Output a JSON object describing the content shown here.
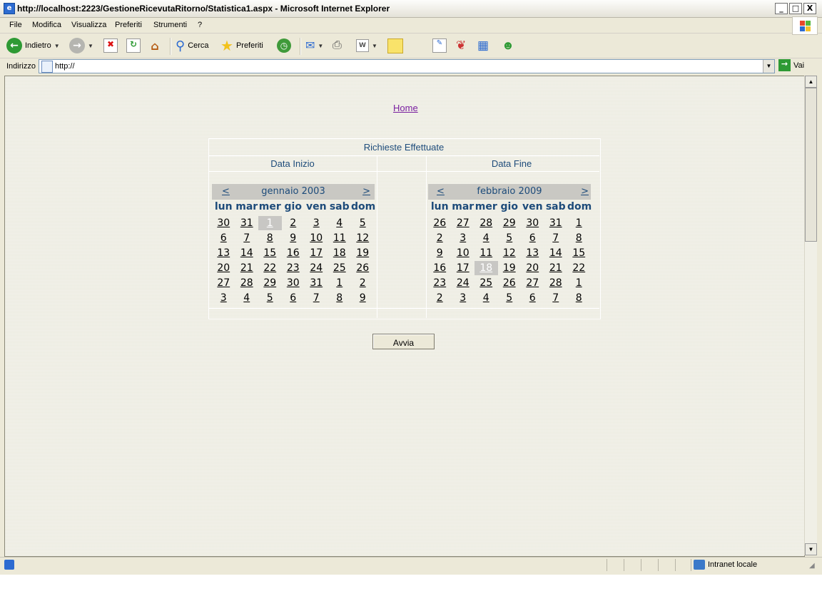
{
  "window": {
    "title": "http://localhost:2223/GestioneRicevutaRitorno/Statistica1.aspx - Microsoft Internet Explorer",
    "controls": [
      "_",
      "□",
      "X"
    ]
  },
  "menu": [
    "File",
    "Modifica",
    "Visualizza",
    "Preferiti",
    "Strumenti",
    "?"
  ],
  "toolbar": {
    "back": "Indietro",
    "search": "Cerca",
    "favorites": "Preferiti"
  },
  "address": {
    "label": "Indirizzo",
    "value": "http://",
    "go": "Vai"
  },
  "page": {
    "home_link": "Home",
    "table_title": "Richieste Effettuate",
    "start_label": "Data Inizio",
    "end_label": "Data Fine",
    "submit": "Avvia"
  },
  "calendars": [
    {
      "prev": "<",
      "next": ">",
      "month": "gennaio 2003",
      "dows": [
        "lun",
        "mar",
        "mer",
        "gio",
        "ven",
        "sab",
        "dom"
      ],
      "weeks": [
        [
          "30",
          "31",
          "1",
          "2",
          "3",
          "4",
          "5"
        ],
        [
          "6",
          "7",
          "8",
          "9",
          "10",
          "11",
          "12"
        ],
        [
          "13",
          "14",
          "15",
          "16",
          "17",
          "18",
          "19"
        ],
        [
          "20",
          "21",
          "22",
          "23",
          "24",
          "25",
          "26"
        ],
        [
          "27",
          "28",
          "29",
          "30",
          "31",
          "1",
          "2"
        ],
        [
          "3",
          "4",
          "5",
          "6",
          "7",
          "8",
          "9"
        ]
      ],
      "selected": [
        0,
        2
      ]
    },
    {
      "prev": "<",
      "next": ">",
      "month": "febbraio 2009",
      "dows": [
        "lun",
        "mar",
        "mer",
        "gio",
        "ven",
        "sab",
        "dom"
      ],
      "weeks": [
        [
          "26",
          "27",
          "28",
          "29",
          "30",
          "31",
          "1"
        ],
        [
          "2",
          "3",
          "4",
          "5",
          "6",
          "7",
          "8"
        ],
        [
          "9",
          "10",
          "11",
          "12",
          "13",
          "14",
          "15"
        ],
        [
          "16",
          "17",
          "18",
          "19",
          "20",
          "21",
          "22"
        ],
        [
          "23",
          "24",
          "25",
          "26",
          "27",
          "28",
          "1"
        ],
        [
          "2",
          "3",
          "4",
          "5",
          "6",
          "7",
          "8"
        ]
      ],
      "selected": [
        3,
        2
      ]
    }
  ],
  "status": {
    "zone": "Intranet locale"
  }
}
